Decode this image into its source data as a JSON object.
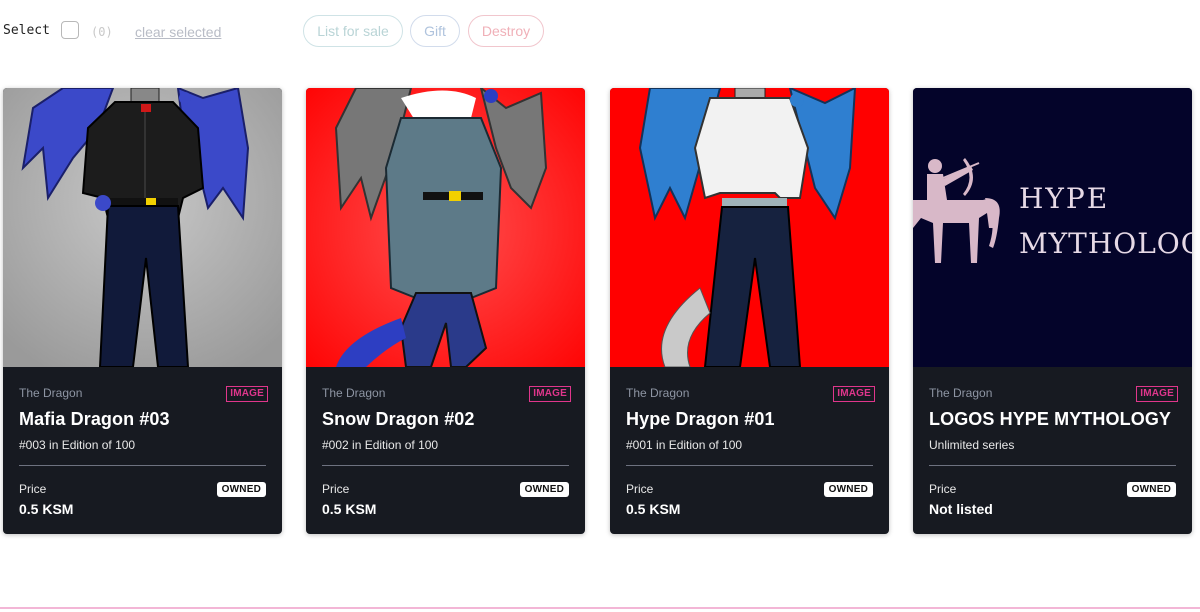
{
  "toolbar": {
    "select_label": "Select",
    "count": "(0)",
    "clear_label": "clear selected",
    "list_label": "List for sale",
    "gift_label": "Gift",
    "destroy_label": "Destroy"
  },
  "cards": [
    {
      "collection": "The Dragon",
      "badge": "IMAGE",
      "title": "Mafia Dragon #03",
      "edition": "#003 in Edition of 100",
      "price_label": "Price",
      "price": "0.5 KSM",
      "status": "OWNED",
      "bg_color": "#a9a9a9"
    },
    {
      "collection": "The Dragon",
      "badge": "IMAGE",
      "title": "Snow Dragon #02",
      "edition": "#002 in Edition of 100",
      "price_label": "Price",
      "price": "0.5 KSM",
      "status": "OWNED",
      "bg_color": "#ff0000"
    },
    {
      "collection": "The Dragon",
      "badge": "IMAGE",
      "title": "Hype Dragon #01",
      "edition": "#001 in Edition of 100",
      "price_label": "Price",
      "price": "0.5 KSM",
      "status": "OWNED",
      "bg_color": "#ff0000"
    },
    {
      "collection": "The Dragon",
      "badge": "IMAGE",
      "title": "LOGOS HYPE MYTHOLOGY",
      "edition": "Unlimited series",
      "price_label": "Price",
      "price": "Not listed",
      "status": "OWNED",
      "bg_color": "#04042a",
      "logo_text_1": "HYPE",
      "logo_text_2": "MYTHOLOGY"
    }
  ],
  "colors": {
    "badge": "#e0368c",
    "card_bg": "#171a21",
    "accent_line": "#f3b6d6"
  }
}
